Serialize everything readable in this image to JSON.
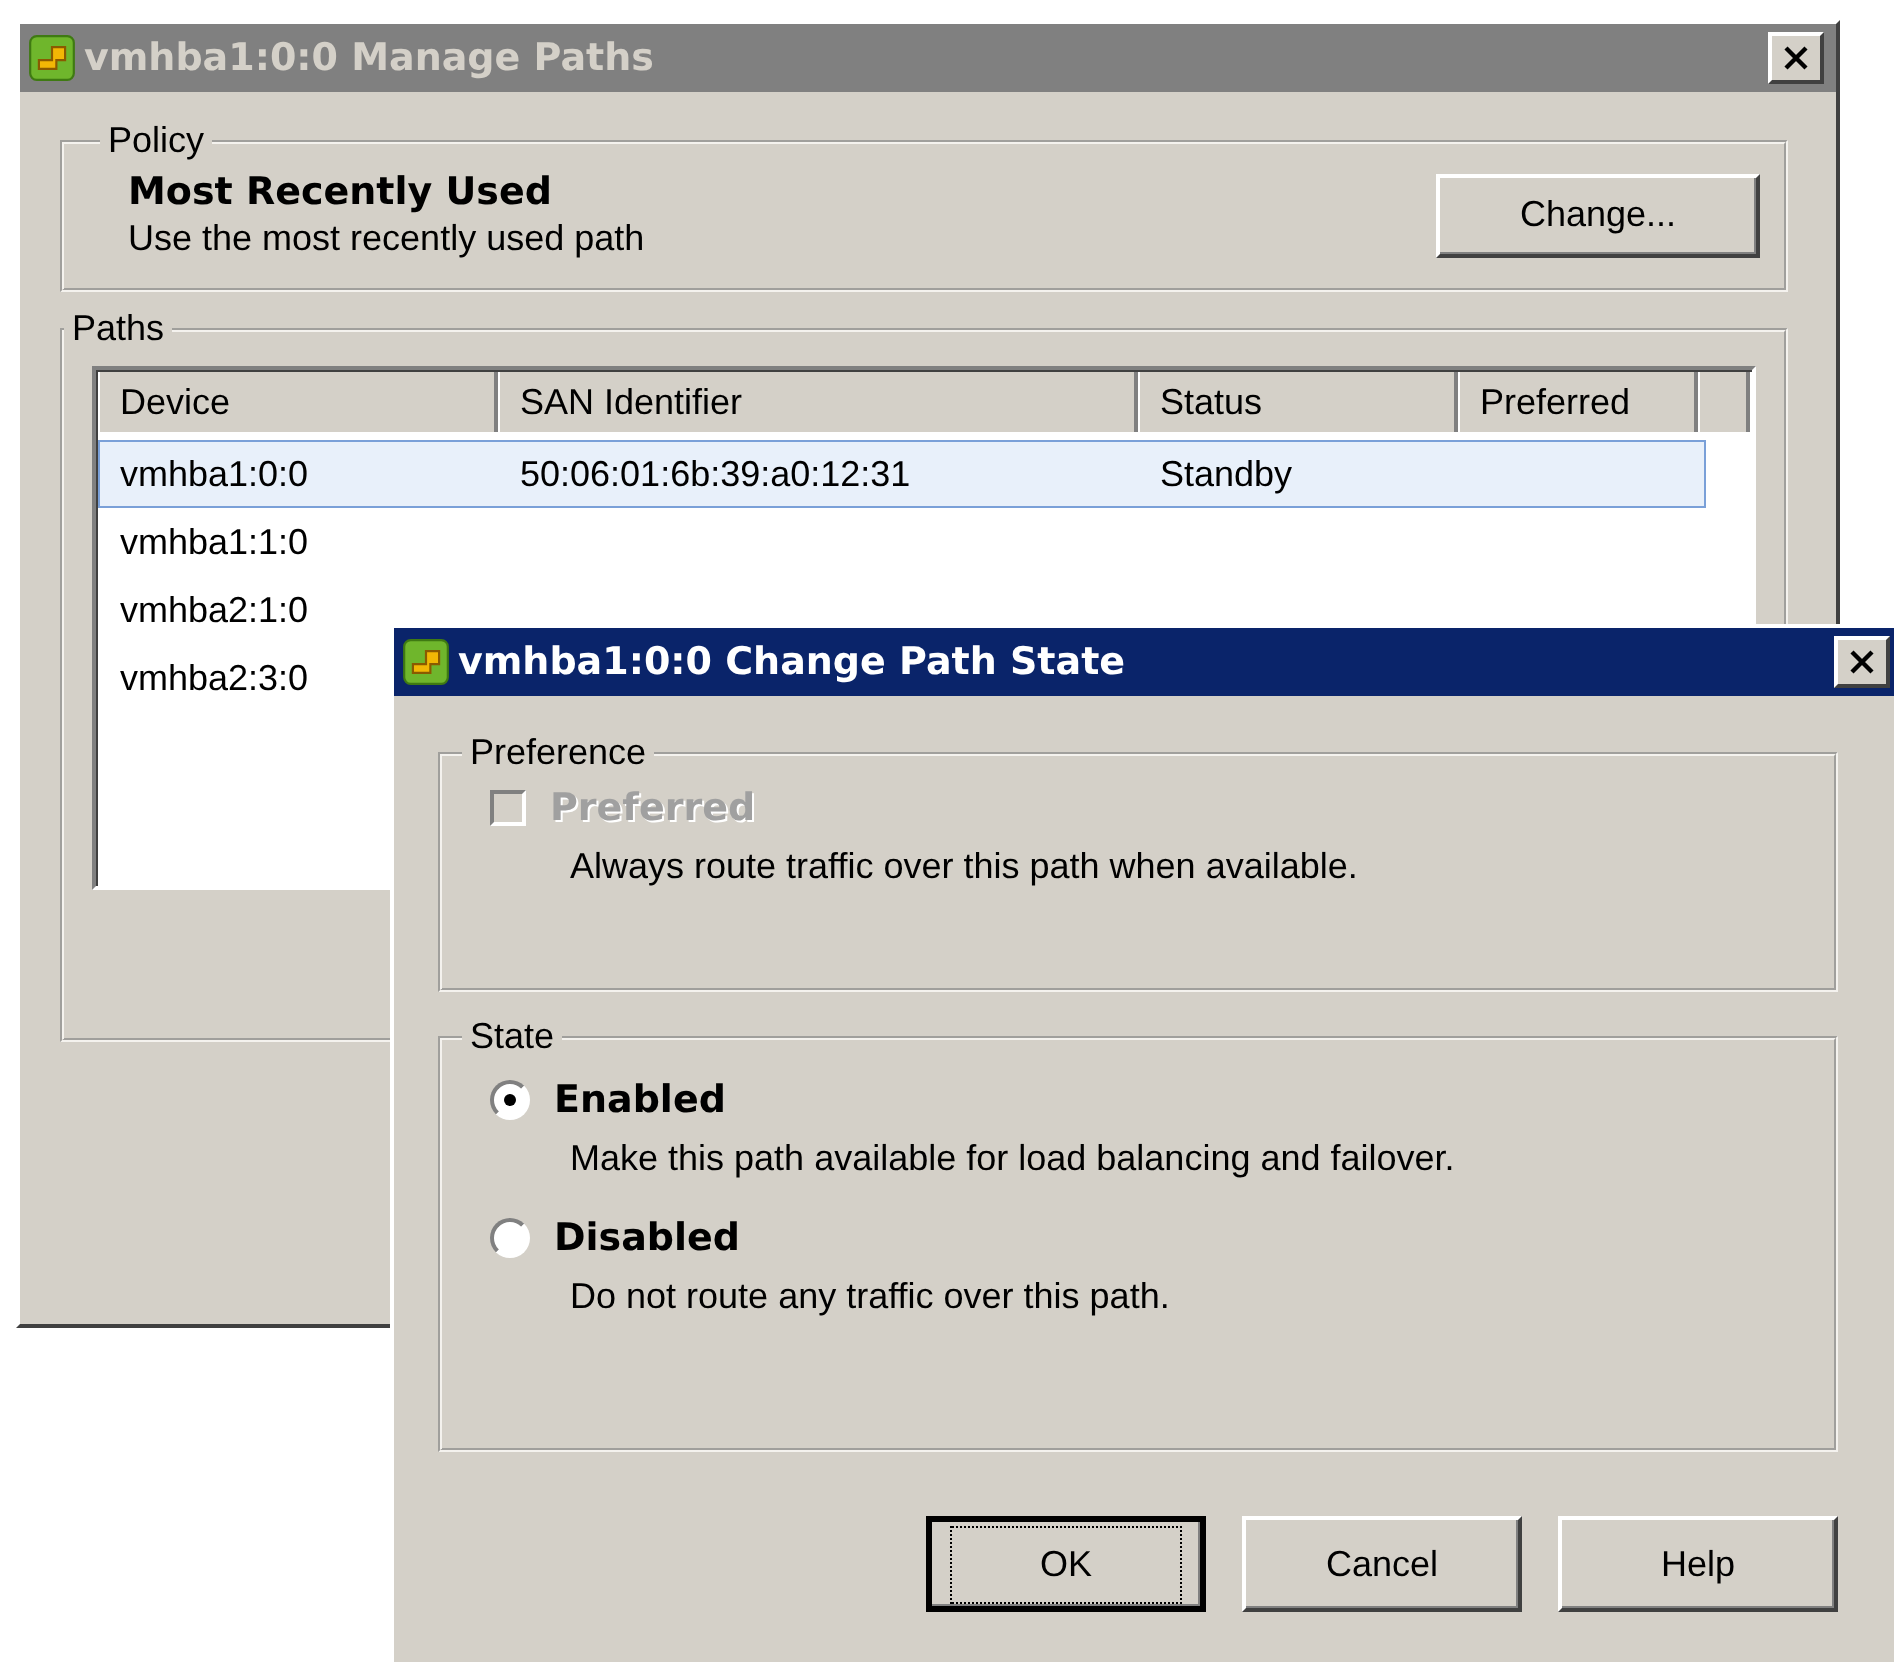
{
  "manage_dialog": {
    "title": "vmhba1:0:0 Manage Paths",
    "active": false,
    "policy": {
      "legend": "Policy",
      "name": "Most Recently Used",
      "description": "Use the most recently used path",
      "button": "Change..."
    },
    "paths": {
      "legend": "Paths",
      "columns": [
        "Device",
        "SAN Identifier",
        "Status",
        "Preferred"
      ],
      "rows": [
        {
          "cells": [
            "vmhba1:0:0",
            "50:06:01:6b:39:a0:12:31",
            "Standby"
          ],
          "selected": true
        },
        {
          "cells": [
            "vmhba1:1:0"
          ],
          "selected": false
        },
        {
          "cells": [
            "vmhba2:1:0"
          ],
          "selected": false
        },
        {
          "cells": [
            "vmhba2:3:0"
          ],
          "selected": false
        }
      ]
    }
  },
  "change_dialog": {
    "title": "vmhba1:0:0 Change Path State",
    "active": true,
    "preference": {
      "legend": "Preference",
      "checkbox": {
        "label": "Preferred",
        "checked": false,
        "disabled": true
      },
      "description": "Always route traffic over this path when available."
    },
    "state": {
      "legend": "State",
      "options": [
        {
          "label": "Enabled",
          "description": "Make this path available for load balancing and failover.",
          "selected": true
        },
        {
          "label": "Disabled",
          "description": "Do not route any traffic over this path.",
          "selected": false
        }
      ]
    },
    "buttons": [
      {
        "label": "OK",
        "default": true
      },
      {
        "label": "Cancel",
        "default": false
      },
      {
        "label": "Help",
        "default": false
      }
    ]
  }
}
